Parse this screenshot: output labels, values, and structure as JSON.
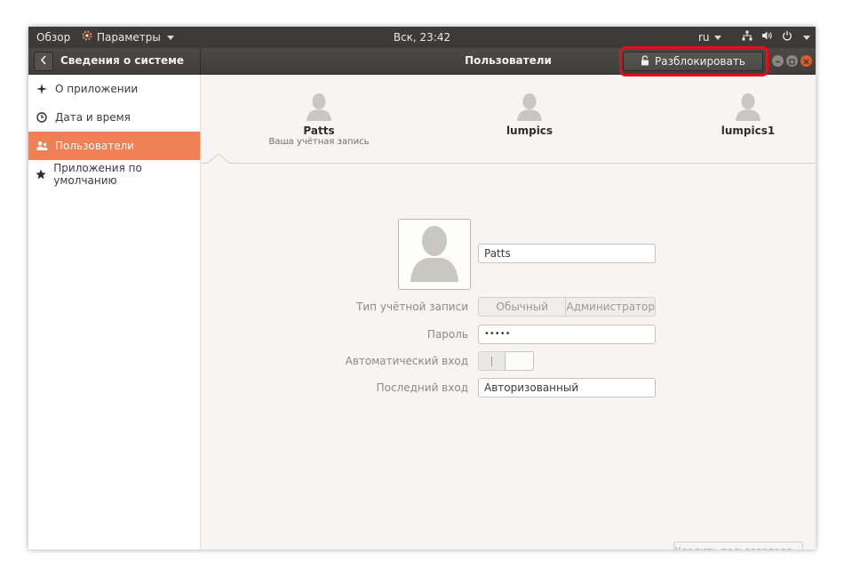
{
  "topbar": {
    "overview": "Обзор",
    "app_menu": "Параметры",
    "clock": "Вск, 23:42",
    "language": "ru"
  },
  "header": {
    "back_title": "Сведения о системе",
    "title": "Пользователи",
    "unlock_label": "Разблокировать"
  },
  "sidebar": {
    "items": [
      {
        "label": "О приложении",
        "icon": "sparkle-icon"
      },
      {
        "label": "Дата и время",
        "icon": "clock-icon"
      },
      {
        "label": "Пользователи",
        "icon": "users-icon",
        "active": true
      },
      {
        "label": "Приложения по умолчанию",
        "icon": "star-icon"
      }
    ]
  },
  "users": [
    {
      "name": "Patts",
      "subtitle": "Ваша учётная запись"
    },
    {
      "name": "lumpics",
      "subtitle": ""
    },
    {
      "name": "lumpics1",
      "subtitle": ""
    }
  ],
  "form": {
    "name_value": "Patts",
    "account_type_label": "Тип учётной записи",
    "account_type_options": [
      "Обычный",
      "Администратор"
    ],
    "password_label": "Пароль",
    "password_value": "•••••",
    "autologin_label": "Автоматический вход",
    "last_login_label": "Последний вход",
    "last_login_value": "Авторизованный"
  },
  "delete_user_label": "Удалить пользователя…",
  "colors": {
    "accent": "#ef7f55",
    "topbar": "#3c3b37",
    "highlight": "#e3101a",
    "close": "#e0592a"
  }
}
